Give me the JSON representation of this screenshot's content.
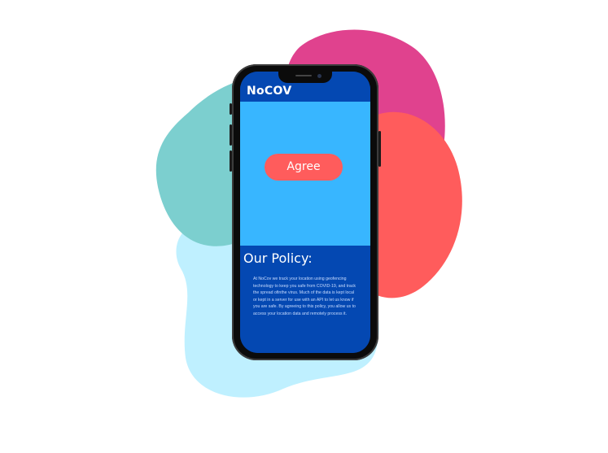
{
  "colors": {
    "teal_blob": "#7ccfcf",
    "pink_blob": "#e0428e",
    "red_blob": "#ff5c5c",
    "light_blue_blob": "#bff0ff",
    "header_blue": "#0448b2",
    "hero_blue": "#38b6ff",
    "button_red": "#ff5c5c"
  },
  "app": {
    "title": "NoCOV"
  },
  "hero": {
    "agree_label": "Agree"
  },
  "policy": {
    "title": "Our Policy:",
    "text": "At NoCov we track your location using geofencing technology to keep you safe from COVID-19, and track the spread ofinthe virus. Much of the data is kept local or kept in a server for use with an API to let us know if you are safe. By agreeing to this policy, you allow us to access your location data and remotely process it."
  }
}
